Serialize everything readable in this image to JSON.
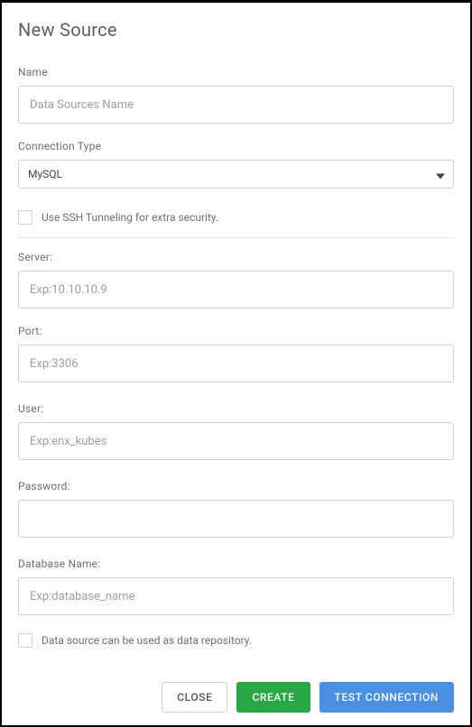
{
  "title": "New Source",
  "fields": {
    "name": {
      "label": "Name",
      "placeholder": "Data Sources Name",
      "value": ""
    },
    "connection_type": {
      "label": "Connection Type",
      "value": "MySQL"
    },
    "ssh": {
      "label": "Use SSH Tunneling for extra security.",
      "checked": false
    },
    "server": {
      "label": "Server:",
      "placeholder": "Exp:10.10.10.9",
      "value": ""
    },
    "port": {
      "label": "Port:",
      "placeholder": "Exp:3306",
      "value": ""
    },
    "user": {
      "label": "User:",
      "placeholder": "Exp:enx_kubes",
      "value": ""
    },
    "password": {
      "label": "Password:",
      "placeholder": "",
      "value": ""
    },
    "database_name": {
      "label": "Database Name:",
      "placeholder": "Exp:database_name",
      "value": ""
    },
    "repo": {
      "label": "Data source can be used as data repository.",
      "checked": false
    }
  },
  "buttons": {
    "close": "CLOSE",
    "create": "CREATE",
    "test": "TEST CONNECTION"
  }
}
